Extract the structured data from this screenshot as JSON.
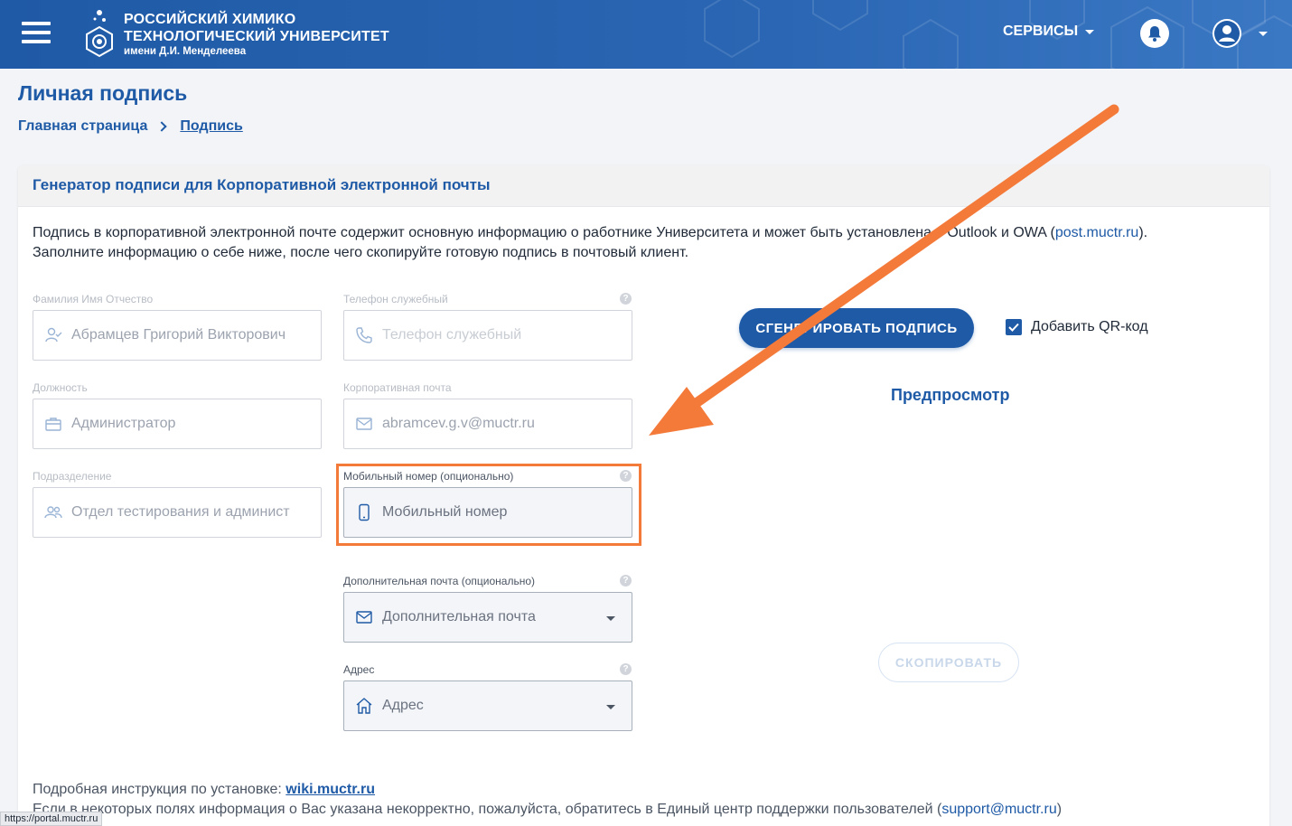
{
  "header": {
    "logo_line1": "РОССИЙСКИЙ ХИМИКО",
    "logo_line2": "ТЕХНОЛОГИЧЕСКИЙ УНИВЕРСИТЕТ",
    "logo_line3": "имени Д.И. Менделеева",
    "services_label": "СЕРВИСЫ"
  },
  "page": {
    "title": "Личная подпись",
    "breadcrumb": [
      "Главная страница",
      "Подпись"
    ]
  },
  "card": {
    "title": "Генератор подписи для Корпоративной электронной почты",
    "intro_part1": "Подпись в корпоративной электронной почте содержит основную информацию о работнике Университета и может быть установлена в Outlook и OWA (",
    "intro_link": "post.muctr.ru",
    "intro_part2": "). Заполните информацию о себе ниже, после чего скопируйте готовую подпись в почтовый клиент."
  },
  "form": {
    "fio_label": "Фамилия Имя Отчество",
    "fio_value": "Абрамцев Григорий Викторович",
    "position_label": "Должность",
    "position_value": "Администратор",
    "department_label": "Подразделение",
    "department_value": "Отдел тестирования и админист",
    "phone_label": "Телефон служебный",
    "phone_placeholder": "Телефон служебный",
    "email_label": "Корпоративная почта",
    "email_value": "abramcev.g.v@muctr.ru",
    "mobile_label": "Мобильный номер (опционально)",
    "mobile_placeholder": "Мобильный номер",
    "extra_email_label": "Дополнительная почта (опционально)",
    "extra_email_placeholder": "Дополнительная почта",
    "address_label": "Адрес",
    "address_placeholder": "Адрес",
    "help_glyph": "?"
  },
  "actions": {
    "generate_label": "СГЕНЕРИРОВАТЬ ПОДПИСЬ",
    "qr_label": "Добавить QR-код",
    "qr_checked": true,
    "preview_label": "Предпросмотр",
    "copy_label": "СКОПИРОВАТЬ"
  },
  "footer": {
    "instruction_prefix": "Подробная инструкция по установке: ",
    "instruction_link": "wiki.muctr.ru",
    "support_prefix": "Если в некоторых полях информация о Вас указана некорректно, пожалуйста, обратитесь в Единый центр поддержки пользователей (",
    "support_link": "support@muctr.ru",
    "support_suffix": ")"
  },
  "status_bar": {
    "url": "https://portal.muctr.ru"
  },
  "colors": {
    "brand": "#1f5aa6",
    "annotation": "#f47a3a"
  }
}
